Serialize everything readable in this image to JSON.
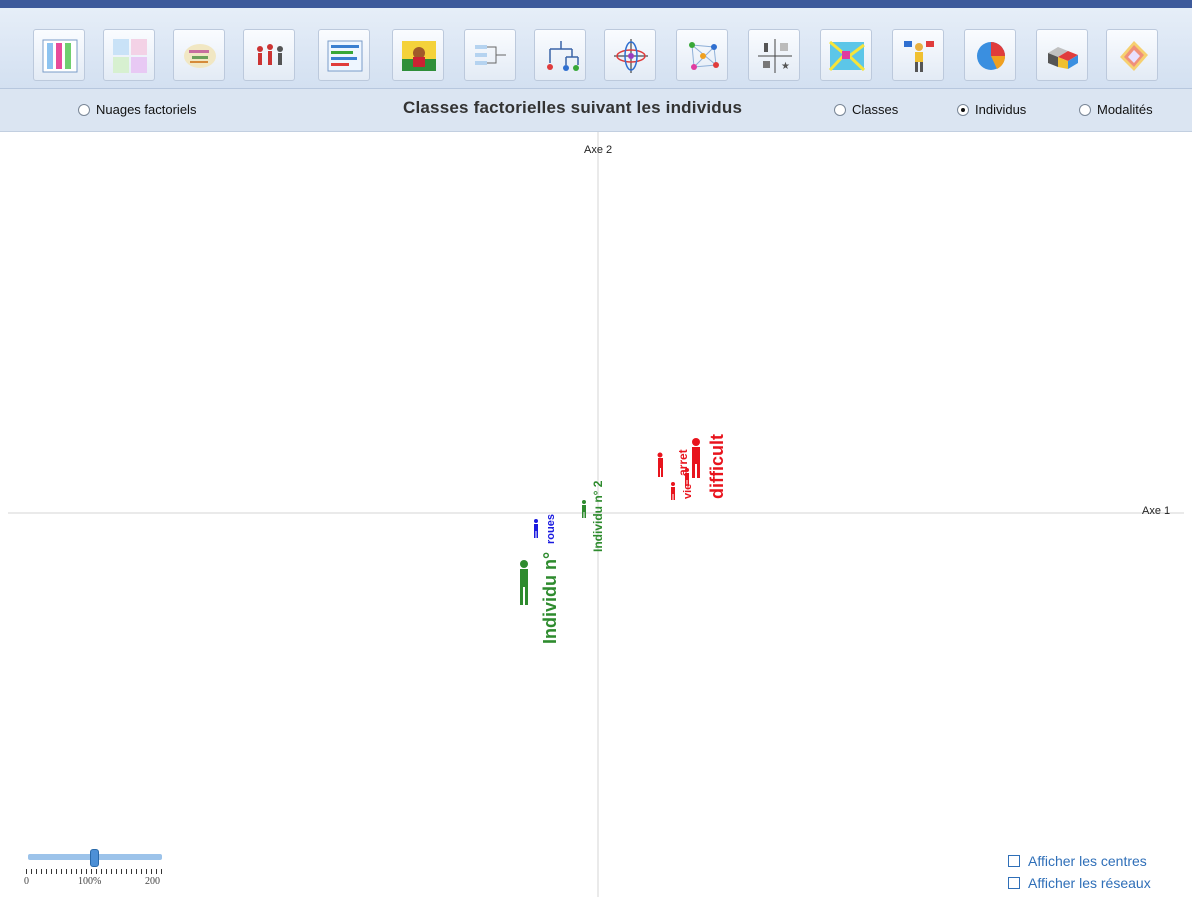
{
  "toolbar": {
    "buttons": [
      {
        "name": "tables-icon"
      },
      {
        "name": "dashboard-icon"
      },
      {
        "name": "word-cloud-icon"
      },
      {
        "name": "people-icon"
      },
      {
        "name": "text-lines-icon"
      },
      {
        "name": "image-icon"
      },
      {
        "name": "flow-icon"
      },
      {
        "name": "dendrogram-icon"
      },
      {
        "name": "factor-axes-icon"
      },
      {
        "name": "network-icon"
      },
      {
        "name": "quadrant-icon"
      },
      {
        "name": "map-icon"
      },
      {
        "name": "presenter-icon"
      },
      {
        "name": "pie-icon"
      },
      {
        "name": "cubes-icon"
      },
      {
        "name": "book-icon"
      }
    ]
  },
  "options": {
    "nuages_label": "Nuages factoriels",
    "title": "Classes factorielles suivant les individus",
    "classes_label": "Classes",
    "individus_label": "Individus",
    "modalites_label": "Modalités",
    "selected": "individus"
  },
  "plot": {
    "axis1_label": "Axe 1",
    "axis2_label": "Axe 2",
    "points": [
      {
        "label": "difficult",
        "color": "#e8141d",
        "size": "large"
      },
      {
        "label": "arret",
        "color": "#e8141d",
        "size": "small"
      },
      {
        "label": "vie",
        "color": "#e8141d",
        "size": "small"
      },
      {
        "label": "Individu n° 2",
        "color": "#2e8b2e",
        "size": "medium"
      },
      {
        "label": "Individu n°",
        "color": "#2e8b2e",
        "size": "large"
      },
      {
        "label": "roues",
        "color": "#1a1adf",
        "size": "small"
      }
    ]
  },
  "checkboxes": {
    "centres_label": "Afficher les centres",
    "reseaux_label": "Afficher les réseaux"
  },
  "zoom": {
    "value_percent": 100,
    "min_label": "0",
    "mid_label": "100%",
    "max_label": "200"
  }
}
